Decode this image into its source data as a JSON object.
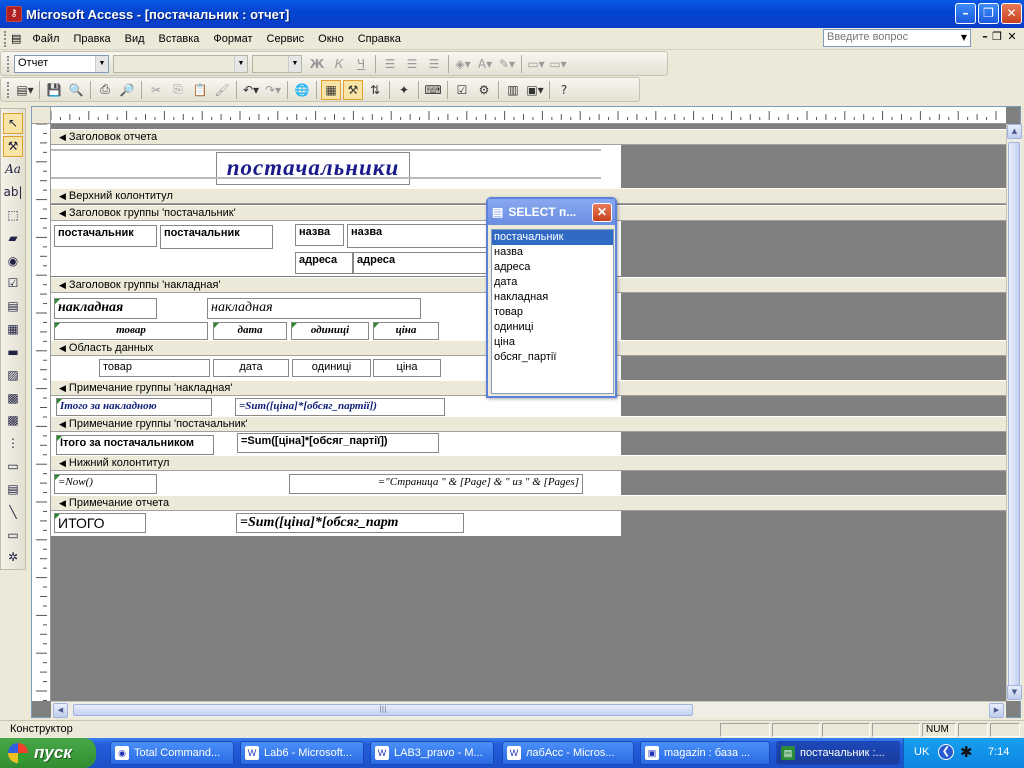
{
  "window": {
    "title": "Microsoft Access - [постачальник : отчет]",
    "app_icon": "key-icon"
  },
  "menu": [
    "Файл",
    "Правка",
    "Вид",
    "Вставка",
    "Формат",
    "Сервис",
    "Окно",
    "Справка"
  ],
  "ask": {
    "placeholder": "Введите вопрос"
  },
  "format_toolbar": {
    "object_combo": "Отчет",
    "font_combo": "",
    "size_combo": ""
  },
  "sections": {
    "report_header": "Заголовок отчета",
    "page_header": "Верхний колонтитул",
    "group_header_supplier": "Заголовок группы 'постачальник'",
    "group_header_invoice": "Заголовок группы 'накладная'",
    "detail": "Область данных",
    "group_footer_invoice": "Примечание группы 'накладная'",
    "group_footer_supplier": "Примечание группы 'постачальник'",
    "page_footer": "Нижний колонтитул",
    "report_footer": "Примечание отчета"
  },
  "controls": {
    "report_title": "постачальники",
    "supplier_label": "постачальник",
    "supplier_field": "постачальник",
    "name_label": "назва",
    "name_field": "назва",
    "address_label": "адреса",
    "address_field": "адреса",
    "invoice_label": "накладная",
    "invoice_field": "накладная",
    "col_product": "товар",
    "col_date": "дата",
    "col_units": "одиниці",
    "col_price": "ціна",
    "d_product": "товар",
    "d_date": "дата",
    "d_units": "одиниці",
    "d_price": "ціна",
    "invoice_total_label": "Ітого за накладною",
    "invoice_total_expr": "=Sum([ціна]*[обсяг_партії])",
    "supplier_total_label": "Ітого за постачальником",
    "supplier_total_expr": "=Sum([ціна]*[обсяг_партії])",
    "now_expr": "=Now()",
    "page_expr": "=\"Страница \" & [Page] & \" из \" & [Pages]",
    "report_total_label": "ИТОГО",
    "report_total_expr": "=Sum([ціна]*[обсяг_парт"
  },
  "field_list": {
    "title": "SELECT п...",
    "items": [
      "постачальник",
      "назва",
      "адреса",
      "дата",
      "накладная",
      "товар",
      "одиниці",
      "ціна",
      "обсяг_партії"
    ],
    "selected": "постачальник"
  },
  "status": {
    "mode": "Конструктор",
    "num": "NUM"
  },
  "taskbar": {
    "start": "пуск",
    "tasks": [
      "Total Command...",
      "Lab6 - Microsoft...",
      "LAB3_pravo - M...",
      "лабAcc - Micros...",
      "magazin : база ...",
      "постачальник :..."
    ],
    "lang": "UK",
    "clock": "7:14"
  },
  "colors": {
    "title_blue": "#0445d0",
    "selection": "#316ac5",
    "report_title_text": "#1a1a8a"
  }
}
